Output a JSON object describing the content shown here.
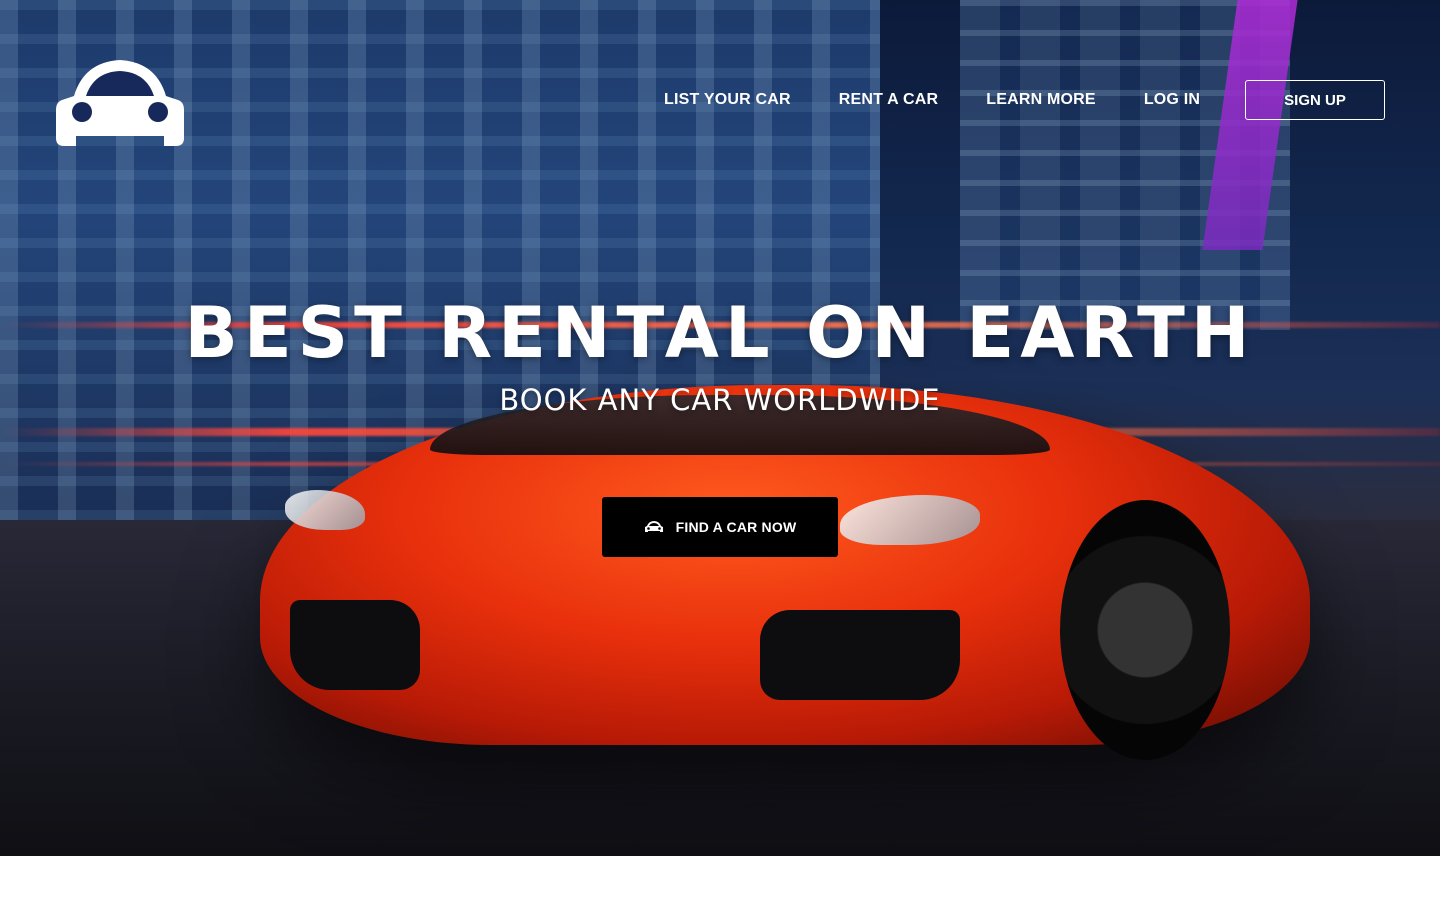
{
  "brand": {
    "logo_icon": "car-icon"
  },
  "nav": {
    "items": [
      {
        "label": "LIST YOUR CAR"
      },
      {
        "label": "RENT A CAR"
      },
      {
        "label": "LEARN MORE"
      },
      {
        "label": "LOG IN"
      }
    ],
    "signup_label": "SIGN UP"
  },
  "hero": {
    "title": "BEST RENTAL ON EARTH",
    "subtitle": "BOOK ANY CAR WORLDWIDE",
    "cta": {
      "label": "FIND A CAR NOW",
      "icon": "car-icon"
    },
    "background_image": "red-sports-car-city-night"
  },
  "colors": {
    "cta_background": "#000000",
    "text": "#ffffff",
    "accent_car": "#e8300c"
  }
}
